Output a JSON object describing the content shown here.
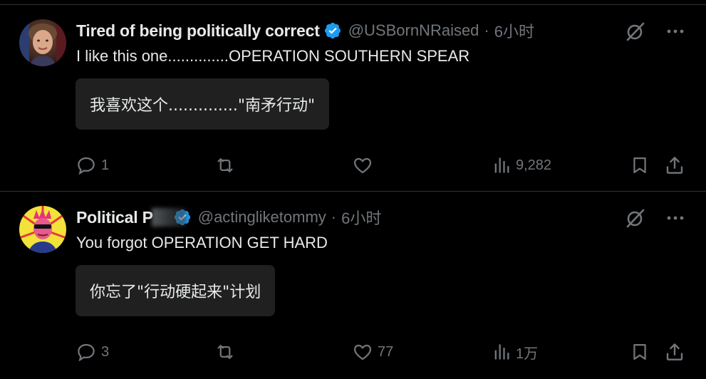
{
  "posts": [
    {
      "author": {
        "display_name": "Tired of being politically correct",
        "handle": "@USBornNRaised",
        "verified": true
      },
      "separator": "·",
      "time": "6小时",
      "text": "I like this one..............OPERATION SOUTHERN SPEAR",
      "translation": "我喜欢这个..............\"南矛行动\"",
      "stats": {
        "replies": "1",
        "reposts": "",
        "likes": "",
        "views": "9,282"
      },
      "icons": {
        "grok": "grok-icon",
        "more": "more-icon",
        "reply": "reply-icon",
        "repost": "repost-icon",
        "like": "heart-icon",
        "views": "views-icon",
        "bookmark": "bookmark-icon",
        "share": "share-icon"
      }
    },
    {
      "author": {
        "display_name": "Political P",
        "handle": "@actingliketommy",
        "verified": true
      },
      "separator": "·",
      "time": "6小时",
      "text": "You forgot OPERATION GET HARD",
      "translation": "你忘了\"行动硬起来\"计划",
      "stats": {
        "replies": "3",
        "reposts": "",
        "likes": "77",
        "views": "1万"
      },
      "icons": {
        "grok": "grok-icon",
        "more": "more-icon",
        "reply": "reply-icon",
        "repost": "repost-icon",
        "like": "heart-icon",
        "views": "views-icon",
        "bookmark": "bookmark-icon",
        "share": "share-icon"
      }
    }
  ],
  "colors": {
    "background": "#000000",
    "text_primary": "#e7e9ea",
    "text_secondary": "#71767b",
    "verified_blue": "#1d9bf0",
    "divider": "#2f3336",
    "translation_bg": "#202020"
  }
}
